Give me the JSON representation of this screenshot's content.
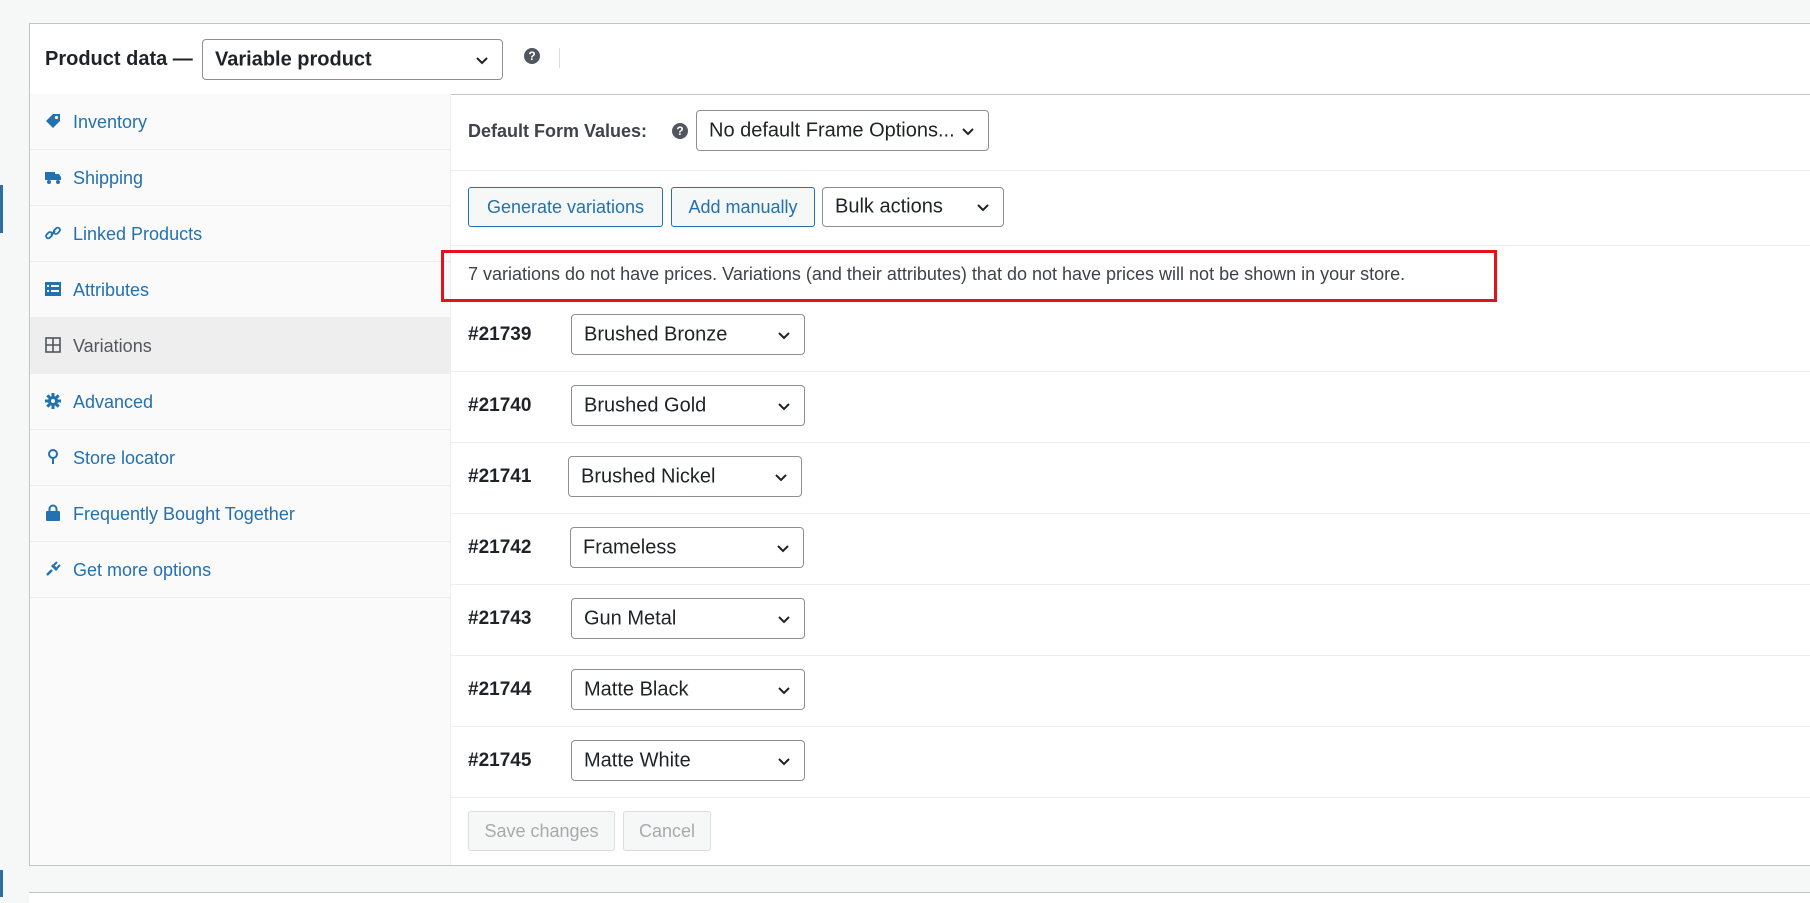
{
  "header": {
    "title": "Product data —",
    "product_type": "Variable product"
  },
  "sidebar": {
    "tabs": [
      {
        "label": "Inventory",
        "icon": "tag-icon"
      },
      {
        "label": "Shipping",
        "icon": "truck-icon"
      },
      {
        "label": "Linked Products",
        "icon": "link-icon"
      },
      {
        "label": "Attributes",
        "icon": "list-icon"
      },
      {
        "label": "Variations",
        "icon": "grid-icon",
        "active": true
      },
      {
        "label": "Advanced",
        "icon": "gear-icon"
      },
      {
        "label": "Store locator",
        "icon": "location-pin-icon"
      },
      {
        "label": "Frequently Bought Together",
        "icon": "bag-icon"
      },
      {
        "label": "Get more options",
        "icon": "plugin-icon"
      }
    ]
  },
  "variations_panel": {
    "default_label": "Default Form Values:",
    "default_value": "No default Frame Options...",
    "buttons": {
      "generate": "Generate variations",
      "add": "Add manually",
      "bulk": "Bulk actions"
    },
    "notice": "7 variations do not have prices. Variations (and their attributes) that do not have prices will not be shown in your store.",
    "variations": [
      {
        "id": "#21739",
        "value": "Brushed Bronze"
      },
      {
        "id": "#21740",
        "value": "Brushed Gold"
      },
      {
        "id": "#21741",
        "value": "Brushed Nickel"
      },
      {
        "id": "#21742",
        "value": "Frameless"
      },
      {
        "id": "#21743",
        "value": "Gun Metal"
      },
      {
        "id": "#21744",
        "value": "Matte Black"
      },
      {
        "id": "#21745",
        "value": "Matte White"
      }
    ],
    "save_label": "Save changes",
    "cancel_label": "Cancel"
  },
  "colors": {
    "link": "#2271b1",
    "highlight_box": "#e3131b",
    "active_tab_bg": "#eeeeee"
  }
}
